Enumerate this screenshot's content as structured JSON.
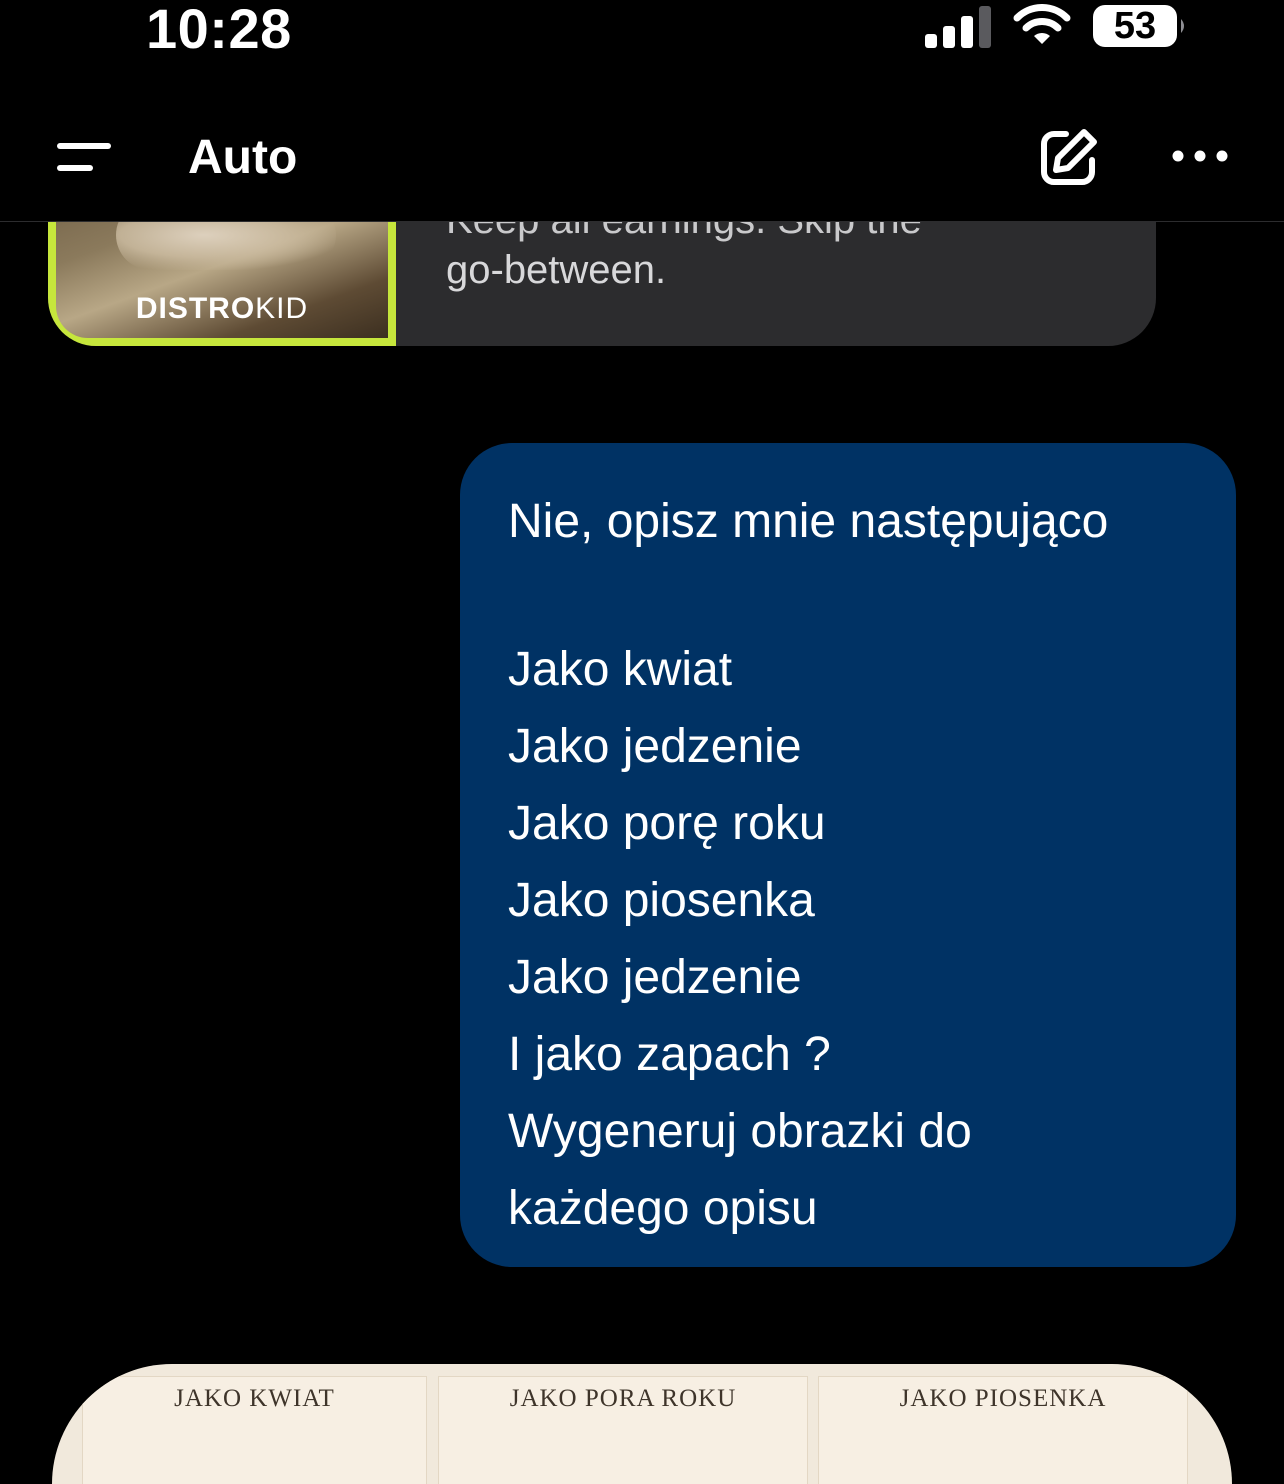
{
  "status_bar": {
    "time": "10:28",
    "battery": "53"
  },
  "nav": {
    "title": "Auto"
  },
  "ad": {
    "brand_bold": "DISTRO",
    "brand_light": "KID",
    "text_clipped": "Keep all earnings. Skip the",
    "text": "go-between."
  },
  "message": {
    "lines": [
      "Nie, opisz mnie następująco",
      "",
      "Jako kwiat",
      "Jako jedzenie",
      "Jako porę roku",
      "Jako piosenka",
      "Jako jedzenie",
      "I jako zapach ?",
      "Wygeneruj obrazki do",
      "każdego opisu"
    ]
  },
  "image_card": {
    "panels": [
      "JAKO KWIAT",
      "JAKO PORA ROKU",
      "JAKO PIOSENKA"
    ]
  },
  "colors": {
    "background": "#000000",
    "user_bubble": "#003264",
    "ad_card": "#2c2c2e",
    "ad_accent": "#c6e63c"
  }
}
